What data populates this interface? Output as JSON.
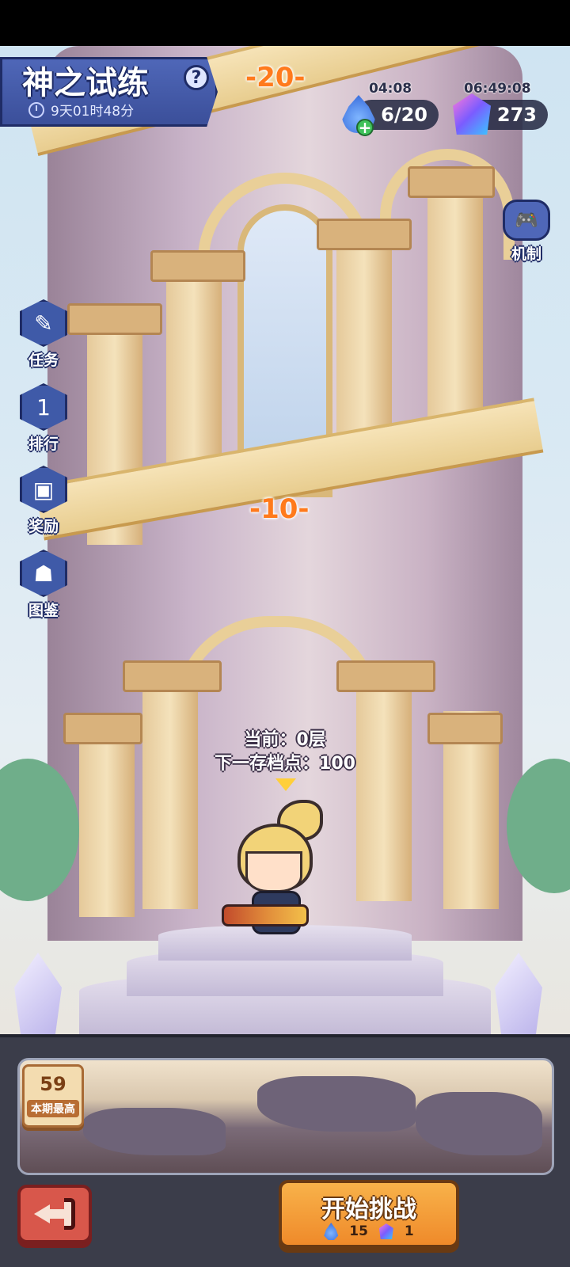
{
  "header": {
    "title": "神之试练",
    "countdown": "9天01时48分",
    "help_icon": "question-icon",
    "timer_icon": "stopwatch-icon"
  },
  "resources": {
    "energy": {
      "timer": "04:08",
      "value": "6/20",
      "icon": "blue-flame-icon"
    },
    "gems": {
      "timer": "06:49:08",
      "value": "273",
      "icon": "crystal-gem-icon"
    }
  },
  "tower": {
    "floor_labels": [
      "-20-",
      "-10-"
    ]
  },
  "side_menu": [
    {
      "label": "任务",
      "icon": "clipboard-icon"
    },
    {
      "label": "排行",
      "icon": "podium-icon"
    },
    {
      "label": "奖励",
      "icon": "chest-icon"
    },
    {
      "label": "图鉴",
      "icon": "monster-book-icon"
    }
  ],
  "mechanics": {
    "label": "机制",
    "icon": "gamepad-icon"
  },
  "status": {
    "current": "当前：0层",
    "next_save": "下一存档点：100"
  },
  "best": {
    "value": "59",
    "label": "本期最高"
  },
  "actions": {
    "start_label": "开始挑战",
    "cost_energy": "15",
    "cost_gem": "1"
  },
  "colors": {
    "accent_blue": "#3f5aa8",
    "floor_label": "#ff7a1c",
    "start_button": "#f8b24a",
    "back_button": "#d8574b"
  }
}
